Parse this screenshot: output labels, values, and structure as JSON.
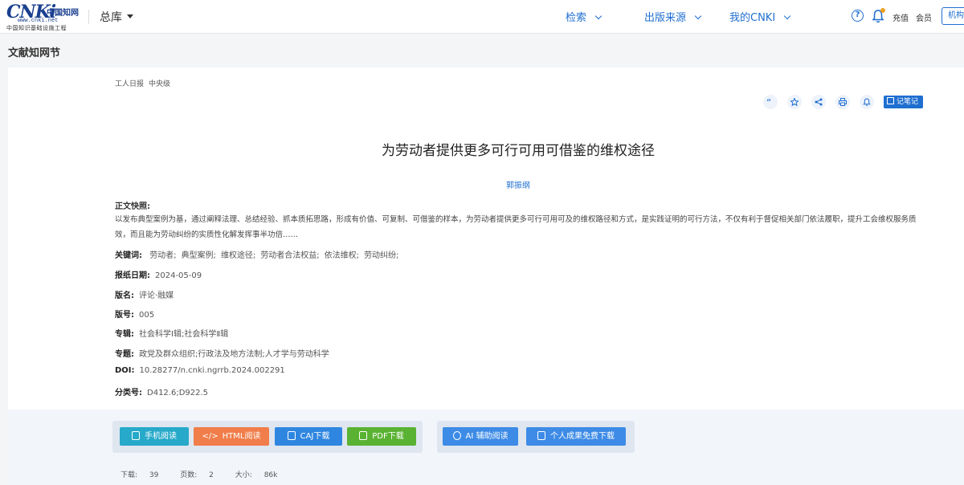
{
  "header": {
    "logo_mark": "CNKi",
    "logo_cn": "中国知网",
    "logo_url": "www.cnki.net",
    "logo_sub": "中国知识基础设施工程",
    "library": "总库",
    "nav": [
      "检索",
      "出版来源",
      "我的CNKI"
    ],
    "recharge": "充值",
    "member": "会员",
    "org": "机构登录"
  },
  "section_title": "文献知网节",
  "article": {
    "source": "工人日报",
    "level": "中央级",
    "note_label": "记笔记",
    "title": "为劳动者提供更多可行可用可借鉴的维权途径",
    "author": "郭振纲",
    "abstract_label": "正文快照:",
    "abstract": "以发布典型案例为基，通过阐释法理、总结经验、抓本质拓思路，形成有价值、可复制、可借鉴的样本，为劳动者提供更多可行可用可及的维权路径和方式，是实践证明的可行方法，不仅有利于督促相关部门依法履职，提升工会维权服务质效，而且能为劳动纠纷的实质性化解发挥事半功倍……",
    "keywords_label": "关键词:",
    "keywords": [
      "劳动者;",
      "典型案例;",
      "维权途径;",
      "劳动者合法权益;",
      "依法维权;",
      "劳动纠纷;"
    ],
    "date_label": "报纸日期:",
    "date": "2024-05-09",
    "edition_name_label": "版名:",
    "edition_name": "评论·融媒",
    "edition_no_label": "版号:",
    "edition_no": "005",
    "series_label": "专辑:",
    "series": "社会科学Ⅰ辑;社会科学Ⅱ辑",
    "topic_label": "专题:",
    "topic": "政党及群众组织;行政法及地方法制;人才学与劳动科学",
    "doi_label": "DOI:",
    "doi": "10.28277/n.cnki.ngrrb.2024.002291",
    "class_label": "分类号:",
    "class_no": "D412.6;D922.5"
  },
  "actions": {
    "mobile": "手机阅读",
    "html": "HTML阅读",
    "caj": "CAJ下载",
    "pdf": "PDF下载",
    "ai": "AI 辅助阅读",
    "free": "个人成果免费下载"
  },
  "colors": {
    "primary": "#1f6fd0",
    "mobile": "#27a9c9",
    "html": "#f07d4a",
    "caj": "#2f86e0",
    "pdf": "#5ab232",
    "ai": "#3d8be6"
  },
  "stats": {
    "downloads_label": "下载:",
    "downloads": "39",
    "pages_label": "页数:",
    "pages": "2",
    "size_label": "大小:",
    "size": "86k"
  }
}
